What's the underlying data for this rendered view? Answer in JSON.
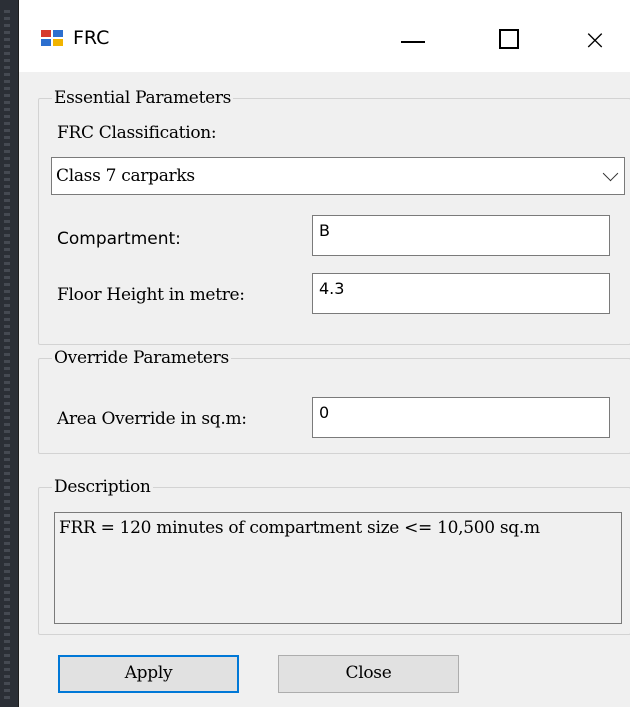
{
  "window": {
    "title": "FRC",
    "controls": {
      "minimize": "—",
      "maximize": "☐",
      "close": "×"
    }
  },
  "essential": {
    "legend": "Essential Parameters",
    "classification_label": "FRC Classification:",
    "classification_value": "Class 7 carparks",
    "compartment_label": "Compartment:",
    "compartment_value": "B",
    "floor_height_label": "Floor Height in metre:",
    "floor_height_value": "4.3"
  },
  "override": {
    "legend": "Override Parameters",
    "area_label": "Area Override in sq.m:",
    "area_value": "0"
  },
  "description": {
    "legend": "Description",
    "text": "FRR = 120 minutes of compartment size <= 10,500 sq.m"
  },
  "buttons": {
    "apply": "Apply",
    "close": "Close"
  },
  "icons": [
    "app-icon",
    "minimize-icon",
    "maximize-icon",
    "close-icon",
    "chevron-down-icon"
  ],
  "colors": {
    "focus_border": "#0078d7",
    "window_bg": "#f0f0f0"
  }
}
